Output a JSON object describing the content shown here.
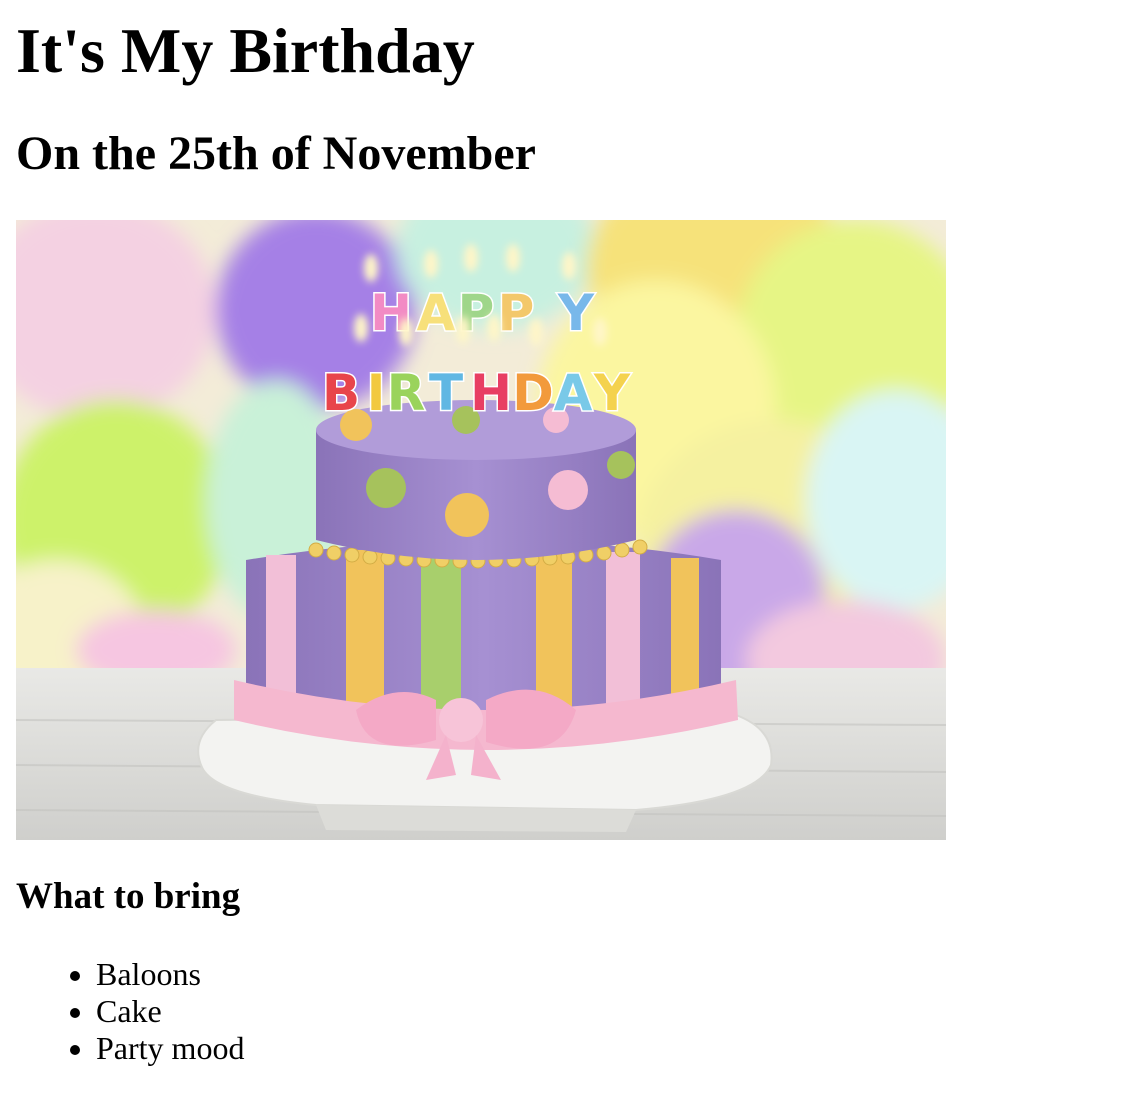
{
  "page": {
    "title": "It's My Birthday",
    "subtitle": "On the 25th of November",
    "image": {
      "alt": "Birthday cake with HAPPY BIRTHDAY candles",
      "candles_row1": "HAPPY",
      "candles_row2": "BIRTHDAY"
    },
    "section_heading": "What to bring",
    "items": [
      "Baloons",
      "Cake",
      "Party mood"
    ]
  }
}
